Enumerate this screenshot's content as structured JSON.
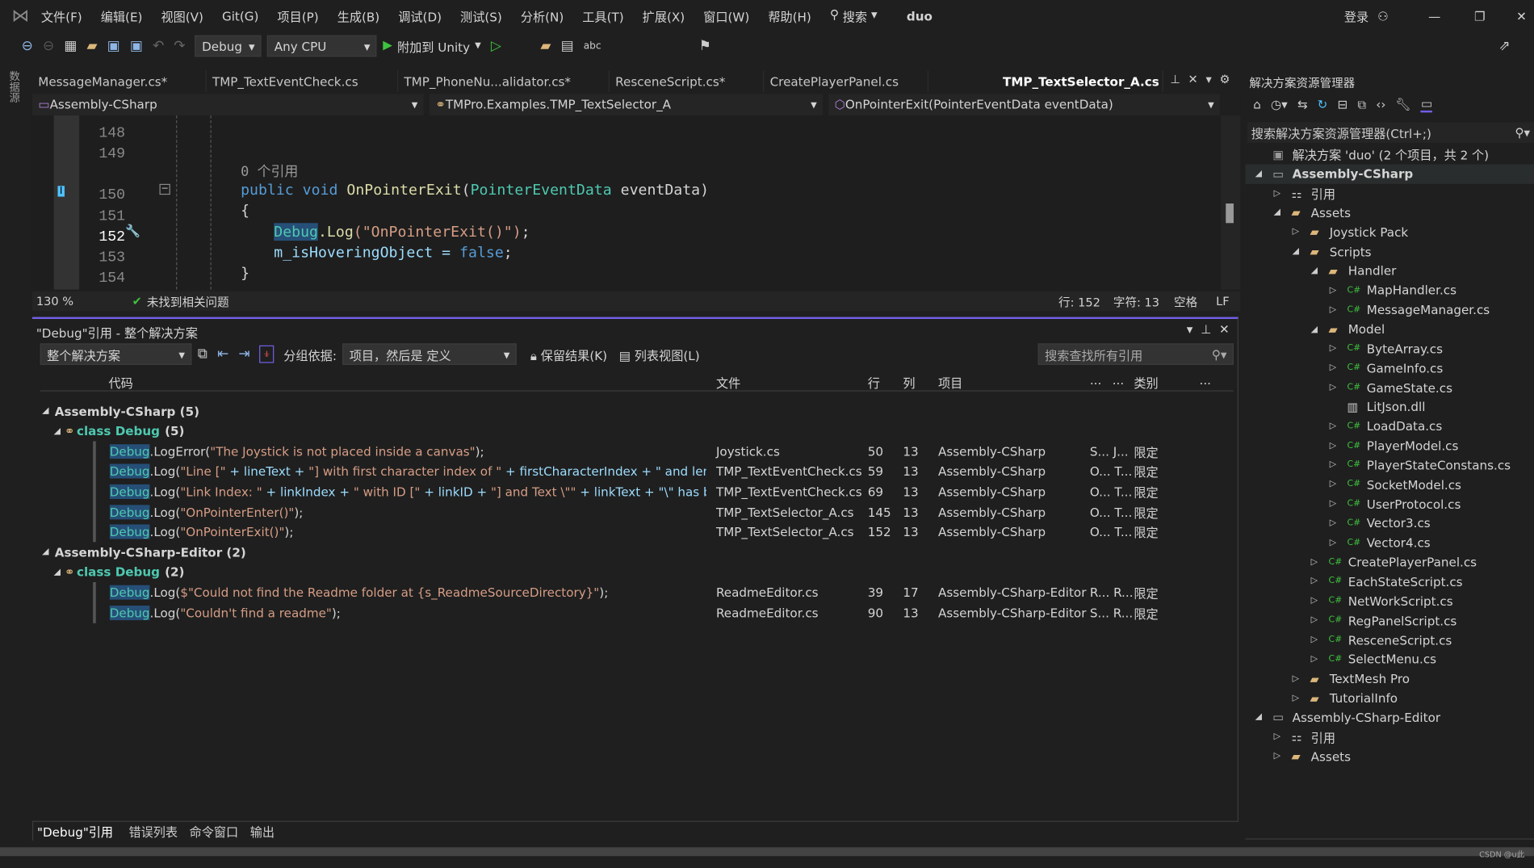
{
  "title": {
    "menu": [
      "文件(F)",
      "编辑(E)",
      "视图(V)",
      "Git(G)",
      "项目(P)",
      "生成(B)",
      "调试(D)",
      "测试(S)",
      "分析(N)",
      "工具(T)",
      "扩展(X)",
      "窗口(W)",
      "帮助(H)"
    ],
    "search": "搜索",
    "solution": "duo",
    "login": "登录"
  },
  "toolbar": {
    "config": "Debug",
    "platform": "Any CPU",
    "attach": "附加到 Unity"
  },
  "side_strip": "数据源",
  "tabs": [
    "MessageManager.cs*",
    "TMP_TextEventCheck.cs",
    "TMP_PhoneNu...alidator.cs*",
    "ResceneScript.cs*",
    "CreatePlayerPanel.cs",
    "TMP_TextSelector_A.cs"
  ],
  "nav": {
    "project": "Assembly-CSharp",
    "type": "TMPro.Examples.TMP_TextSelector_A",
    "member": "OnPointerExit(PointerEventData eventData)"
  },
  "editor": {
    "lines": [
      "148",
      "149",
      "150",
      "151",
      "152",
      "153",
      "154"
    ],
    "ref_hint": "0 个引用",
    "code": {
      "public": "public",
      "void": "void",
      "method": "OnPointerExit",
      "paren": "(",
      "ptype": "PointerEventData",
      "pname": " eventData)",
      "open": "{",
      "debug": "Debug",
      "log": ".Log",
      "arg": "(\"OnPointerExit()\")",
      "semi": ";",
      "field": "m_isHoveringObject = ",
      "false": "false",
      "close": "}"
    }
  },
  "status": {
    "zoom": "130 %",
    "issues": "未找到相关问题",
    "line": "行: 152",
    "char": "字符: 13",
    "spaces": "空格",
    "eol": "LF"
  },
  "refs": {
    "title": "\"Debug\"引用 - 整个解决方案",
    "scope": "整个解决方案",
    "group_label": "分组依据:",
    "group_value": "项目，然后是 定义",
    "keep": "保留结果(K)",
    "listview": "列表视图(L)",
    "search_placeholder": "搜索查找所有引用",
    "headers": {
      "code": "代码",
      "file": "文件",
      "line": "行",
      "col": "列",
      "project": "项目",
      "e1": "...",
      "e2": "...",
      "kind": "类别",
      "e3": "..."
    },
    "groups": [
      {
        "name": "Assembly-CSharp (5)",
        "class": "class Debug",
        "count": "(5)",
        "rows": [
          {
            "rest": ".LogError(\"The Joystick is not placed inside a canvas\");",
            "file": "Joystick.cs",
            "line": "50",
            "col": "13",
            "project": "Assembly-CSharp",
            "a": "S... J...",
            "kind": "限定"
          },
          {
            "rest": ".Log(\"Line [\" + lineText + \"] with first character index of \" + firstCharacterIndex + \" and length...",
            "file": "TMP_TextEventCheck.cs",
            "line": "59",
            "col": "13",
            "project": "Assembly-CSharp",
            "a": "O... T...",
            "kind": "限定"
          },
          {
            "rest": ".Log(\"Link Index: \" + linkIndex + \" with ID [\" + linkID + \"] and Text \\\"\" + linkText + \"\\\" has been...",
            "file": "TMP_TextEventCheck.cs",
            "line": "69",
            "col": "13",
            "project": "Assembly-CSharp",
            "a": "O... T...",
            "kind": "限定"
          },
          {
            "rest": ".Log(\"OnPointerEnter()\");",
            "file": "TMP_TextSelector_A.cs",
            "line": "145",
            "col": "13",
            "project": "Assembly-CSharp",
            "a": "O... T...",
            "kind": "限定"
          },
          {
            "rest": ".Log(\"OnPointerExit()\");",
            "file": "TMP_TextSelector_A.cs",
            "line": "152",
            "col": "13",
            "project": "Assembly-CSharp",
            "a": "O... T...",
            "kind": "限定"
          }
        ]
      },
      {
        "name": "Assembly-CSharp-Editor (2)",
        "class": "class Debug",
        "count": "(2)",
        "rows": [
          {
            "rest": ".Log($\"Could not find the Readme folder at {s_ReadmeSourceDirectory}\");",
            "file": "ReadmeEditor.cs",
            "line": "39",
            "col": "17",
            "project": "Assembly-CSharp-Editor",
            "a": "R... R...",
            "kind": "限定"
          },
          {
            "rest": ".Log(\"Couldn't find a readme\");",
            "file": "ReadmeEditor.cs",
            "line": "90",
            "col": "13",
            "project": "Assembly-CSharp-Editor",
            "a": "S... R...",
            "kind": "限定"
          }
        ]
      }
    ],
    "debug": "Debug"
  },
  "bottom_tabs": [
    "\"Debug\"引用",
    "错误列表",
    "命令窗口",
    "输出"
  ],
  "explorer": {
    "title": "解决方案资源管理器",
    "search": "搜索解决方案资源管理器(Ctrl+;)",
    "items": [
      {
        "t": "解决方案 'duo' (2 个项目，共 2 个)",
        "l": 0,
        "i": "sln",
        "e": ""
      },
      {
        "t": "Assembly-CSharp",
        "l": 0,
        "i": "proj",
        "e": "◢",
        "b": true
      },
      {
        "t": "引用",
        "l": 1,
        "i": "ref",
        "e": "▷"
      },
      {
        "t": "Assets",
        "l": 1,
        "i": "folder",
        "e": "◢"
      },
      {
        "t": "Joystick Pack",
        "l": 2,
        "i": "folder",
        "e": "▷"
      },
      {
        "t": "Scripts",
        "l": 2,
        "i": "folder",
        "e": "◢"
      },
      {
        "t": "Handler",
        "l": 3,
        "i": "folder",
        "e": "◢"
      },
      {
        "t": "MapHandler.cs",
        "l": 4,
        "i": "cs",
        "e": "▷"
      },
      {
        "t": "MessageManager.cs",
        "l": 4,
        "i": "cs",
        "e": "▷"
      },
      {
        "t": "Model",
        "l": 3,
        "i": "folder",
        "e": "◢"
      },
      {
        "t": "ByteArray.cs",
        "l": 4,
        "i": "cs",
        "e": "▷"
      },
      {
        "t": "GameInfo.cs",
        "l": 4,
        "i": "cs",
        "e": "▷"
      },
      {
        "t": "GameState.cs",
        "l": 4,
        "i": "cs",
        "e": "▷"
      },
      {
        "t": "LitJson.dll",
        "l": 4,
        "i": "dll",
        "e": ""
      },
      {
        "t": "LoadData.cs",
        "l": 4,
        "i": "cs",
        "e": "▷"
      },
      {
        "t": "PlayerModel.cs",
        "l": 4,
        "i": "cs",
        "e": "▷"
      },
      {
        "t": "PlayerStateConstans.cs",
        "l": 4,
        "i": "cs",
        "e": "▷"
      },
      {
        "t": "SocketModel.cs",
        "l": 4,
        "i": "cs",
        "e": "▷"
      },
      {
        "t": "UserProtocol.cs",
        "l": 4,
        "i": "cs",
        "e": "▷"
      },
      {
        "t": "Vector3.cs",
        "l": 4,
        "i": "cs",
        "e": "▷"
      },
      {
        "t": "Vector4.cs",
        "l": 4,
        "i": "cs",
        "e": "▷"
      },
      {
        "t": "CreatePlayerPanel.cs",
        "l": 3,
        "i": "cs",
        "e": "▷"
      },
      {
        "t": "EachStateScript.cs",
        "l": 3,
        "i": "cs",
        "e": "▷"
      },
      {
        "t": "NetWorkScript.cs",
        "l": 3,
        "i": "cs",
        "e": "▷"
      },
      {
        "t": "RegPanelScript.cs",
        "l": 3,
        "i": "cs",
        "e": "▷"
      },
      {
        "t": "ResceneScript.cs",
        "l": 3,
        "i": "cs",
        "e": "▷"
      },
      {
        "t": "SelectMenu.cs",
        "l": 3,
        "i": "cs",
        "e": "▷"
      },
      {
        "t": "TextMesh Pro",
        "l": 2,
        "i": "folder",
        "e": "▷"
      },
      {
        "t": "TutorialInfo",
        "l": 2,
        "i": "folder",
        "e": "▷"
      },
      {
        "t": "Assembly-CSharp-Editor",
        "l": 0,
        "i": "proj",
        "e": "◢"
      },
      {
        "t": "引用",
        "l": 1,
        "i": "ref",
        "e": "▷"
      },
      {
        "t": "Assets",
        "l": 1,
        "i": "folder",
        "e": "▷"
      }
    ]
  },
  "watermark": "CSDN @u此",
  "colors": {
    "accent": "#7160e8",
    "type": "#4ec9b0",
    "keyword": "#569cd6",
    "string": "#d69d85",
    "highlight": "#264f78"
  }
}
